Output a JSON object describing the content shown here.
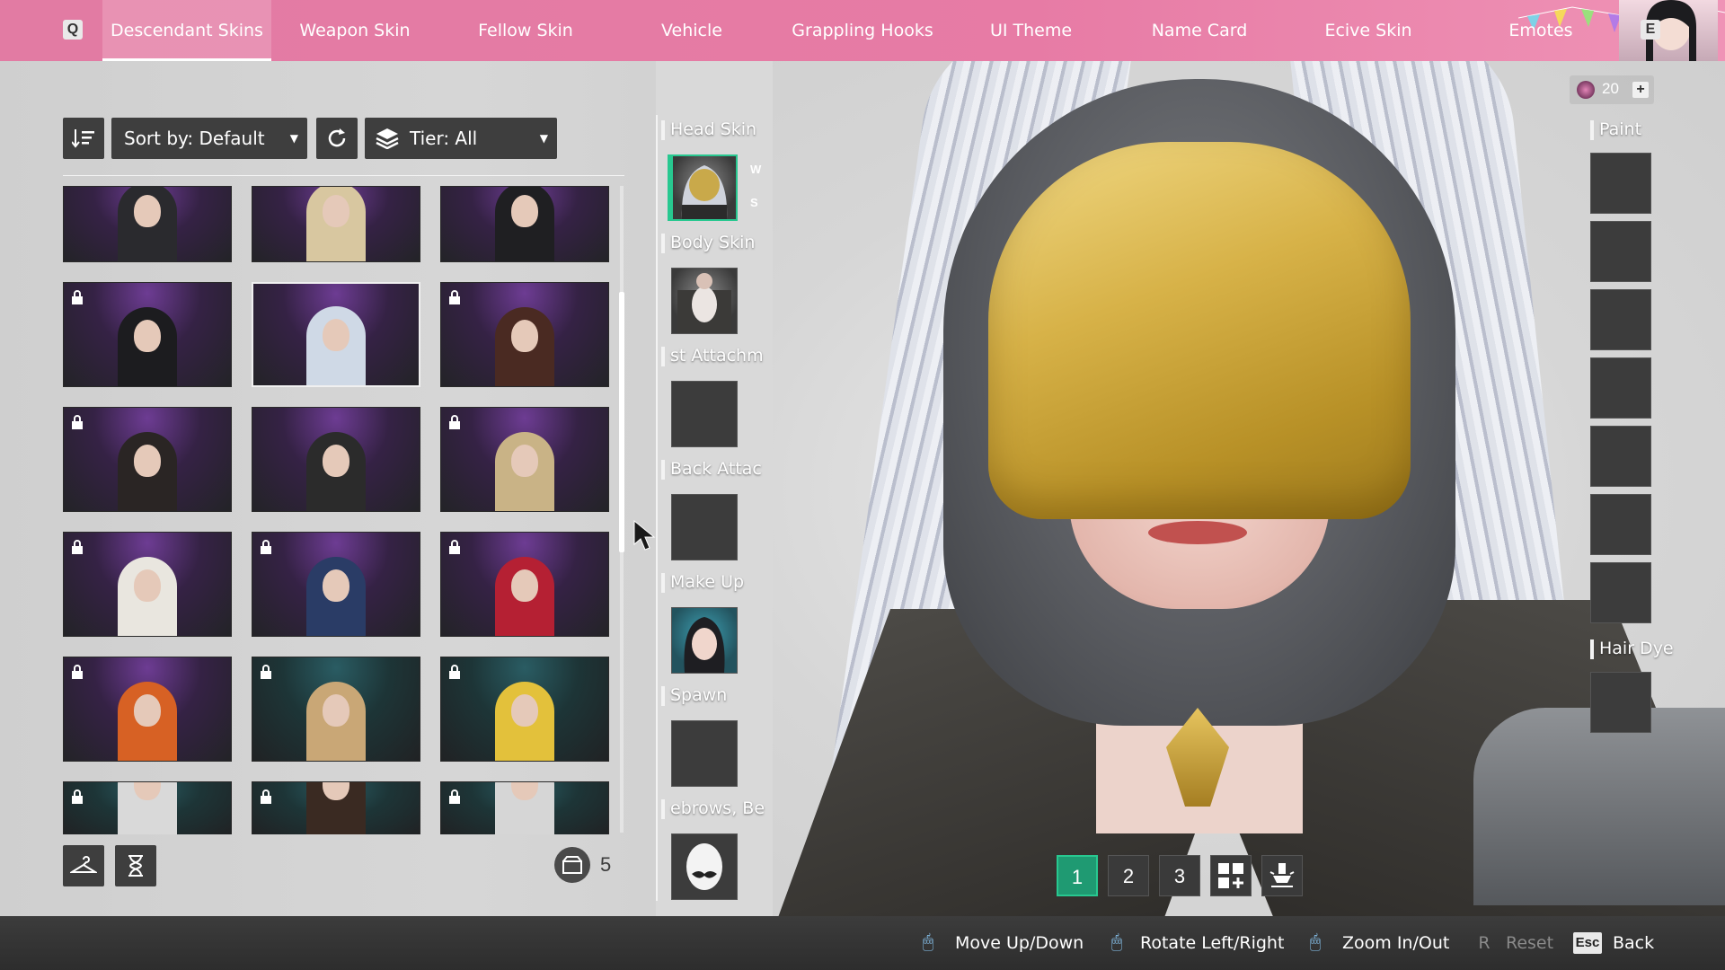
{
  "topbar": {
    "left_key": "Q",
    "right_key": "E",
    "tabs": [
      {
        "label": "Descendant Skins",
        "active": true
      },
      {
        "label": "Weapon Skin",
        "active": false
      },
      {
        "label": "Fellow Skin",
        "active": false
      },
      {
        "label": "Vehicle",
        "active": false
      },
      {
        "label": "Grappling Hooks",
        "active": false
      },
      {
        "label": "UI Theme",
        "active": false
      },
      {
        "label": "Name Card",
        "active": false
      },
      {
        "label": "Ecive Skin",
        "active": false
      },
      {
        "label": "Emotes",
        "active": false
      }
    ]
  },
  "filters": {
    "sort_label": "Sort by: Default",
    "tier_label": "Tier: All"
  },
  "skins_grid": {
    "items": [
      {
        "locked": false,
        "theme": "purple",
        "selected": false
      },
      {
        "locked": false,
        "theme": "purple",
        "selected": false
      },
      {
        "locked": false,
        "theme": "purple",
        "selected": false
      },
      {
        "locked": true,
        "theme": "purple",
        "selected": false
      },
      {
        "locked": false,
        "theme": "purple",
        "selected": true
      },
      {
        "locked": true,
        "theme": "purple",
        "selected": false
      },
      {
        "locked": true,
        "theme": "purple",
        "selected": false
      },
      {
        "locked": false,
        "theme": "purple",
        "selected": false
      },
      {
        "locked": true,
        "theme": "purple",
        "selected": false
      },
      {
        "locked": true,
        "theme": "purple",
        "selected": false
      },
      {
        "locked": true,
        "theme": "purple",
        "selected": false
      },
      {
        "locked": true,
        "theme": "purple",
        "selected": false
      },
      {
        "locked": true,
        "theme": "purple",
        "selected": false
      },
      {
        "locked": true,
        "theme": "teal",
        "selected": false
      },
      {
        "locked": true,
        "theme": "teal",
        "selected": false
      },
      {
        "locked": true,
        "theme": "teal",
        "selected": false
      },
      {
        "locked": true,
        "theme": "teal",
        "selected": false
      },
      {
        "locked": true,
        "theme": "teal",
        "selected": false
      }
    ],
    "box_count": "5"
  },
  "slots": {
    "head_skin": "Head Skin",
    "head_w": "W",
    "head_s": "S",
    "body_skin": "Body Skin",
    "front_attach": "st Attachm",
    "back_attach": "Back Attac",
    "make_up": "Make Up",
    "spawn": "Spawn",
    "eyebrows": "ebrows, Be"
  },
  "right_panel": {
    "currency_value": "20",
    "paint_label": "Paint",
    "hair_dye_label": "Hair Dye"
  },
  "presets": [
    "1",
    "2",
    "3"
  ],
  "bottom_hints": {
    "move": "Move Up/Down",
    "rotate": "Rotate Left/Right",
    "zoom": "Zoom In/Out",
    "reset_key": "R",
    "reset": "Reset",
    "esc_key": "Esc",
    "back": "Back"
  },
  "colors": {
    "topbar_pink": "#e27ba3",
    "active_green": "#28c890",
    "panel_dark": "#3e3e3e"
  }
}
